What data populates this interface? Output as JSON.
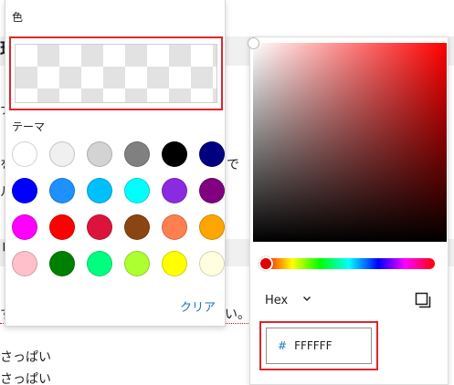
{
  "document": {
    "heading_1_fragment": "理",
    "body_fragment_1": "ナ",
    "body_fragment_2": "を",
    "body_fragment_3": "で",
    "body_fragment_4": "ル",
    "heading_2_fragment": "リ",
    "body_fragment_5": "す",
    "body_fragment_6": "い。",
    "list_item_1": "さっぱい",
    "list_item_2": "さっぱい"
  },
  "color_popover": {
    "title": "色",
    "theme_label": "テーマ",
    "clear_label": "クリア",
    "swatches": [
      {
        "name": "white",
        "hex": "#ffffff"
      },
      {
        "name": "light-gray",
        "hex": "#f0f0f0"
      },
      {
        "name": "silver",
        "hex": "#d3d3d3"
      },
      {
        "name": "gray",
        "hex": "#808080"
      },
      {
        "name": "black",
        "hex": "#000000"
      },
      {
        "name": "navy",
        "hex": "#000080"
      },
      {
        "name": "blue",
        "hex": "#0000ff"
      },
      {
        "name": "dodger-blue",
        "hex": "#1e90ff"
      },
      {
        "name": "deep-sky-blue",
        "hex": "#00bfff"
      },
      {
        "name": "cyan",
        "hex": "#00ffff"
      },
      {
        "name": "blue-violet",
        "hex": "#8a2be2"
      },
      {
        "name": "purple",
        "hex": "#800080"
      },
      {
        "name": "magenta",
        "hex": "#ff00ff"
      },
      {
        "name": "red",
        "hex": "#ff0000"
      },
      {
        "name": "crimson",
        "hex": "#dc143c"
      },
      {
        "name": "saddle-brown",
        "hex": "#8b4513"
      },
      {
        "name": "coral",
        "hex": "#ff7f50"
      },
      {
        "name": "orange",
        "hex": "#ffa500"
      },
      {
        "name": "pink",
        "hex": "#ffc0cb"
      },
      {
        "name": "green",
        "hex": "#008000"
      },
      {
        "name": "spring-green",
        "hex": "#00ff7f"
      },
      {
        "name": "green-yellow",
        "hex": "#adff2f"
      },
      {
        "name": "yellow",
        "hex": "#ffff00"
      },
      {
        "name": "light-yellow",
        "hex": "#ffffe0"
      }
    ]
  },
  "color_picker": {
    "hue_color": "#ff0000",
    "format_label": "Hex",
    "hash_symbol": "#",
    "hex_value": "FFFFFF",
    "copy_icon": "copy-icon",
    "format_chevron_icon": "chevron-down-icon"
  },
  "colors": {
    "accent": "#1e73be",
    "highlight_border": "#e0252a"
  }
}
